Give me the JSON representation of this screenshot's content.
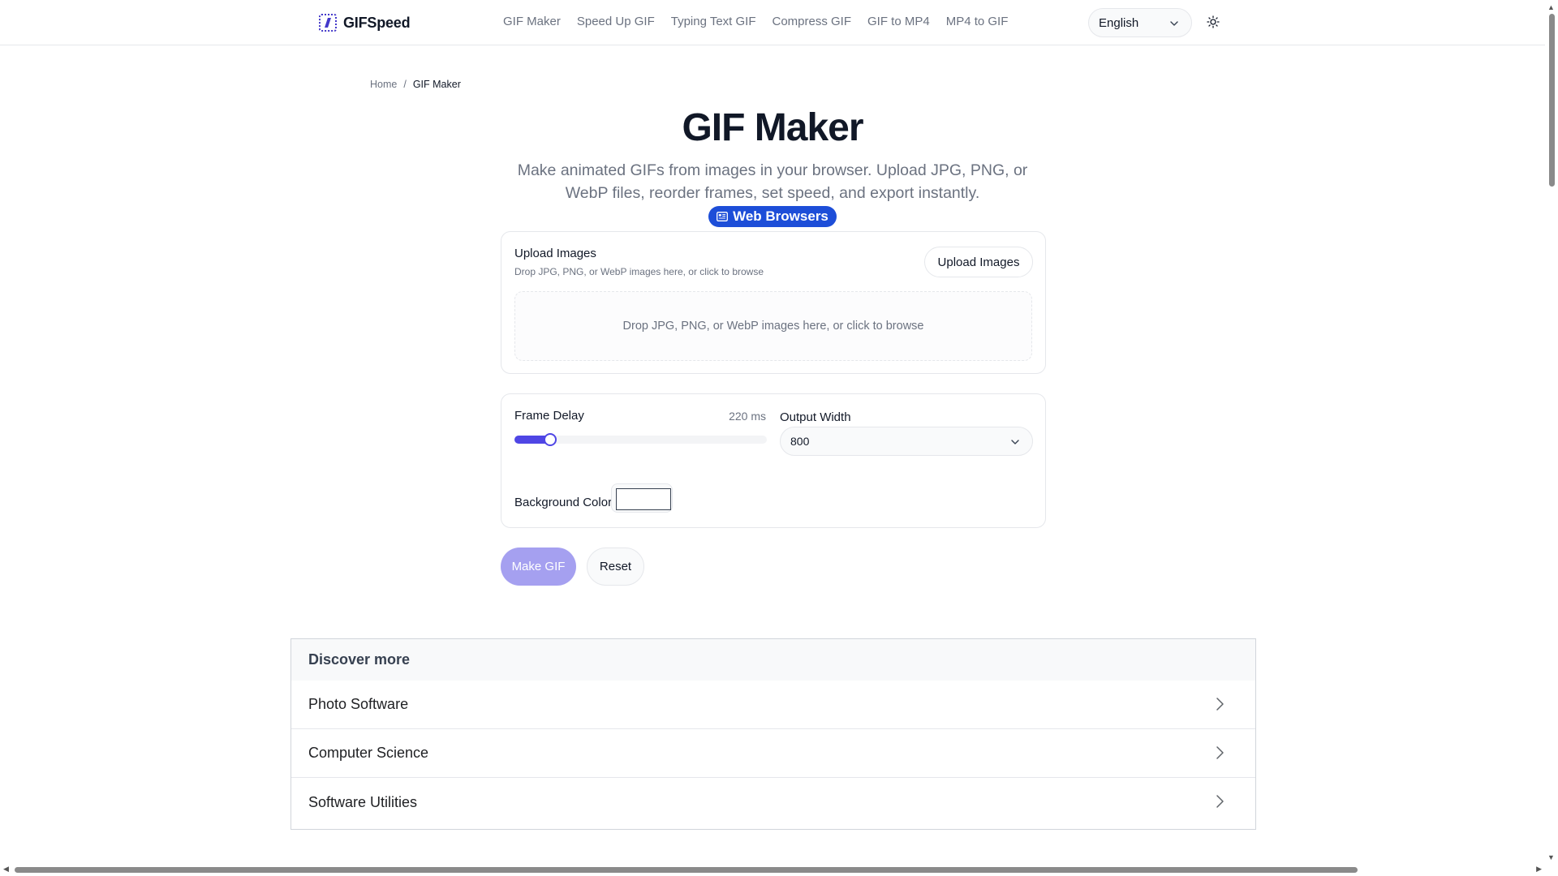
{
  "header": {
    "logo_text": "GIFSpeed",
    "nav": [
      {
        "label": "GIF Maker"
      },
      {
        "label": "Speed Up GIF"
      },
      {
        "label": "Typing Text GIF"
      },
      {
        "label": "Compress GIF"
      },
      {
        "label": "GIF to MP4"
      },
      {
        "label": "MP4 to GIF"
      }
    ],
    "language": "English",
    "theme_icon": "sun-icon"
  },
  "breadcrumb": {
    "home": "Home",
    "separator": "/",
    "current": "GIF Maker"
  },
  "hero": {
    "title": "GIF Maker",
    "subtitle": "Make animated GIFs from images in your browser. Upload JPG, PNG, or WebP files, reorder frames, set speed, and export instantly.",
    "badge_label": "Web Browsers",
    "badge_icon": "newspaper-icon",
    "badge_color": "#1d4ed8"
  },
  "upload": {
    "title": "Upload Images",
    "hint": "Drop JPG, PNG, or WebP images here, or click to browse",
    "button_label": "Upload Images",
    "dropzone_text": "Drop JPG, PNG, or WebP images here, or click to browse"
  },
  "settings": {
    "frame_delay_label": "Frame Delay",
    "frame_delay_value": "220 ms",
    "frame_delay_fraction": 0.14,
    "output_width_label": "Output Width",
    "output_width_value": "800",
    "background_color_label": "Background Color",
    "background_color_value": "#ffffff",
    "accent_color": "#4f46e5"
  },
  "actions": {
    "make_label": "Make GIF",
    "reset_label": "Reset",
    "make_color": "#a5a0f0"
  },
  "discover": {
    "title": "Discover more",
    "items": [
      {
        "label": "Photo Software"
      },
      {
        "label": "Computer Science"
      },
      {
        "label": "Software Utilities"
      }
    ]
  }
}
